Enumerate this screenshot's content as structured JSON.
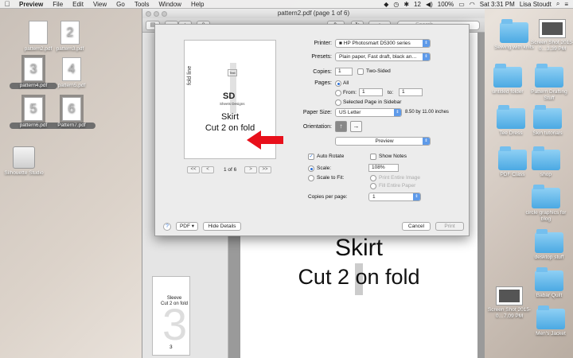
{
  "menubar": {
    "apple": "",
    "app": "Preview",
    "items": [
      "File",
      "Edit",
      "View",
      "Go",
      "Tools",
      "Window",
      "Help"
    ],
    "status": {
      "badge": "12",
      "battery": "100%",
      "clock": "Sat 3:31 PM",
      "user": "Lisa Stoudt"
    }
  },
  "desktop": {
    "left_icons": [
      {
        "label": "pattern2.pdf",
        "glyph": ""
      },
      {
        "label": "pattern3.pdf",
        "glyph": "2"
      },
      {
        "label": "pattern4.pdf",
        "glyph": "3"
      },
      {
        "label": "pattern5.pdf",
        "glyph": "4"
      },
      {
        "label": "pattern6.pdf",
        "glyph": "5"
      },
      {
        "label": "Pattern7.pdf",
        "glyph": "6"
      }
    ],
    "drive": "Silhouette Studio",
    "right_icons": [
      "Sewing with knits",
      "Screen Shot 2015-0…3.39 PM",
      "untitled folder",
      "Pattern Drafting Stuff",
      "Tee Dress",
      "Skin tutorials",
      "PDF Class",
      "shop",
      "circle graphics for blog",
      "desktop stuff",
      "Babar Quilt",
      "Screen Shot 2015-0…7.09 PM",
      "Men's Jacket"
    ]
  },
  "window": {
    "title": "pattern2.pdf (page 1 of 6)",
    "search_placeholder": "Search",
    "big_page": {
      "line1": "Skirt",
      "line2": "Cut 2 on fold"
    },
    "sidebar_thumb": {
      "label1": "Sleeve",
      "label2": "Cut 2 on fold",
      "page_number": "3"
    }
  },
  "print": {
    "preview": {
      "fold_text": "fold line",
      "logo": "SD",
      "logo_sub": "Sheets Designs",
      "title": "Skirt",
      "subtitle": "Cut 2 on fold",
      "page_indicator": "1 of 6",
      "nav": [
        "<<",
        "<",
        ">",
        ">>"
      ]
    },
    "printer_label": "Printer:",
    "printer_value": "HP Photosmart D5300 series",
    "presets_label": "Presets:",
    "presets_value": "Plain paper, Fast draft, black an…",
    "copies_label": "Copies:",
    "copies_value": "1",
    "two_sided": "Two-Sided",
    "pages_label": "Pages:",
    "pages_all": "All",
    "pages_from": "From:",
    "from_value": "1",
    "to_label": "to:",
    "to_value": "1",
    "selected_in_sidebar": "Selected Page in Sidebar",
    "paper_label": "Paper Size:",
    "paper_value": "US Letter",
    "paper_dims": "8.50 by 11.00 inches",
    "orientation_label": "Orientation:",
    "section_value": "Preview",
    "auto_rotate": "Auto Rotate",
    "show_notes": "Show Notes",
    "scale_label": "Scale:",
    "scale_value": "108%",
    "scale_to_fit": "Scale to Fit:",
    "print_entire_image": "Print Entire Image",
    "fill_entire_paper": "Fill Entire Paper",
    "copies_per_page_label": "Copies per page:",
    "copies_per_page_value": "1",
    "help": "?",
    "pdf_button": "PDF",
    "hide_details": "Hide Details",
    "cancel": "Cancel",
    "print_button": "Print"
  },
  "colors": {
    "accent": "#2a6fd6",
    "arrow": "#e8101b",
    "folder": "#5fb6ea"
  }
}
